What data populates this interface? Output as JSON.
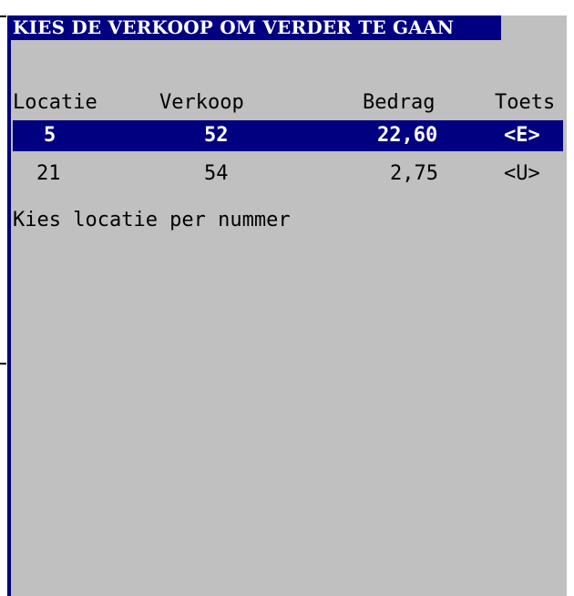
{
  "title": "KIES DE VERKOOP OM VERDER TE GAAN",
  "columns": {
    "location": "Locatie",
    "sale": "Verkoop",
    "amount": "Bedrag",
    "key": "Toets"
  },
  "rows": [
    {
      "location": "5",
      "sale": "52",
      "amount": "22,60",
      "key": "<E>",
      "selected": true
    },
    {
      "location": "21",
      "sale": "54",
      "amount": "2,75",
      "key": "<U>",
      "selected": false
    }
  ],
  "prompt": "Kies locatie per nummer",
  "colors": {
    "background": "#c0c0c0",
    "accent": "#000080",
    "text": "#000000",
    "selected_text": "#ffffff"
  }
}
